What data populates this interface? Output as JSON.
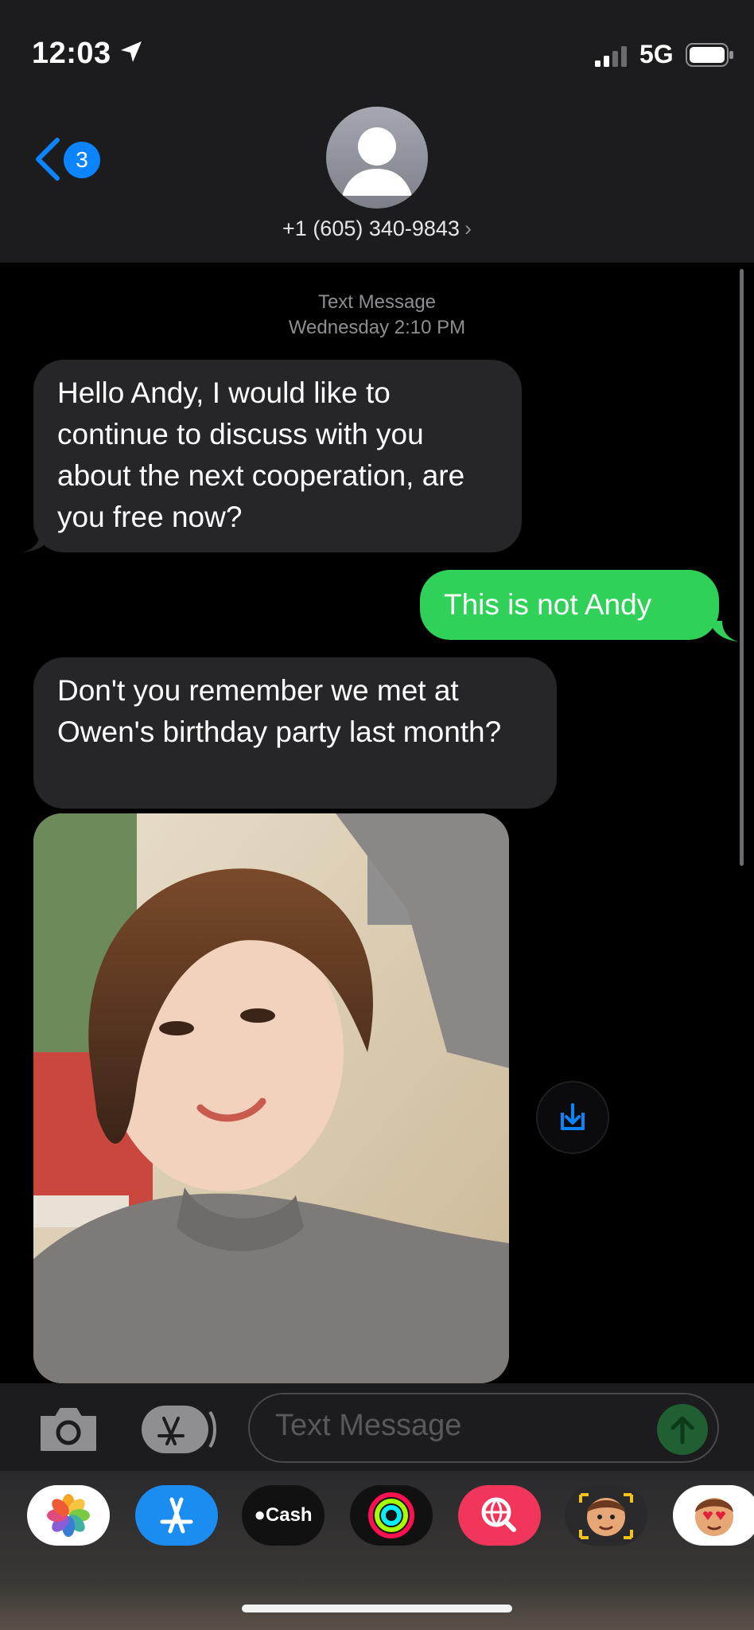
{
  "status_bar": {
    "time": "12:03",
    "network": "5G",
    "location_icon": "location-arrow-icon",
    "signal_icon": "signal-bars-icon",
    "battery_icon": "battery-icon"
  },
  "header": {
    "back_badge": "3",
    "contact": "+1 (605) 340-9843",
    "chevron": "›"
  },
  "thread": {
    "service": "Text Message",
    "timestamp": "Wednesday 2:10 PM",
    "messages": [
      {
        "direction": "incoming",
        "text": "Hello Andy, I would like to continue to discuss with you about the next cooperation, are you free now?"
      },
      {
        "direction": "outgoing",
        "text": "This is not Andy"
      },
      {
        "direction": "incoming",
        "text": "Don't you remember we met at Owen's birthday party last month?"
      },
      {
        "direction": "incoming",
        "type": "photo"
      }
    ]
  },
  "compose": {
    "placeholder": "Text Message"
  },
  "app_drawer": {
    "apps": [
      {
        "name": "photos-app-icon"
      },
      {
        "name": "app-store-icon"
      },
      {
        "name": "apple-cash-icon",
        "label": "Cash"
      },
      {
        "name": "activity-icon"
      },
      {
        "name": "web-search-icon"
      },
      {
        "name": "memoji-icon"
      },
      {
        "name": "memoji-stickers-icon"
      }
    ]
  },
  "colors": {
    "incoming_bubble": "#262629",
    "outgoing_bubble": "#30d158",
    "accent": "#0a84ff"
  }
}
